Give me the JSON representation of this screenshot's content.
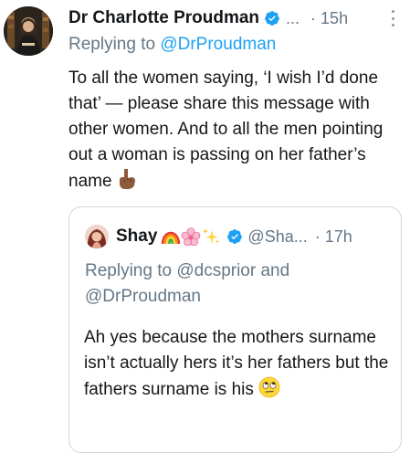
{
  "tweet": {
    "author_name": "Dr Charlotte Proudman",
    "handle_truncated": "...",
    "timestamp": "· 15h",
    "replying_prefix": "Replying to ",
    "replying_handle": "@DrProudman",
    "body": "To all the women saying, ‘I wish I’d done that’ — please share this message with other women. And to all the men pointing out a woman is passing on her father’s name",
    "body_emoji": "pointing-down-hand-medium-dark-skin"
  },
  "quoted_tweet": {
    "author_name": "Shay",
    "name_emojis": [
      "rainbow",
      "cherry-blossom",
      "sparkles"
    ],
    "handle_truncated": "@Sha...",
    "timestamp": "· 17h",
    "replying_text": "Replying to @dcsprior and @DrProudman",
    "body": "Ah yes because the mothers surname isn’t actually hers it’s her fathers but the fathers surname is his",
    "body_emoji": "face-with-rolling-eyes"
  },
  "colors": {
    "verified_blue": "#1da1f2",
    "link_blue": "#1da1f2",
    "secondary_text": "#657786",
    "primary_text": "#14171a",
    "card_border": "#ccd6dd"
  }
}
